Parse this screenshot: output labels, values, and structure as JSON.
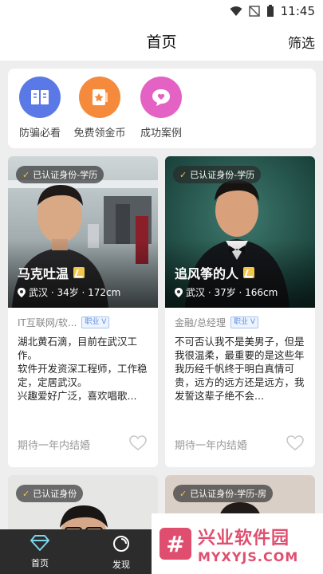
{
  "statusbar": {
    "time": "11:45"
  },
  "header": {
    "title": "首页",
    "filter": "筛选"
  },
  "quicknav": [
    {
      "label": "防骗必看",
      "icon": "book-icon",
      "color": "#5b79e6"
    },
    {
      "label": "免费领金币",
      "icon": "gift-icon",
      "color": "#f58a3c"
    },
    {
      "label": "成功案例",
      "icon": "heart-chat-icon",
      "color": "#e462c4"
    }
  ],
  "cards": [
    {
      "verify": "已认证身份-学历",
      "name": "马克吐温",
      "info": "武汉 · 34岁 · 172cm",
      "job": "IT互联网/软...",
      "job_badge": "职业",
      "intro": [
        "湖北黄石滴，目前在武汉工作。",
        "软件开发资深工程师，工作稳定，定居武汉。",
        "兴趣爱好广泛，喜欢唱歌..."
      ],
      "expect": "期待一年内结婚"
    },
    {
      "verify": "已认证身份-学历",
      "name": "追风筝的人",
      "info": "武汉 · 37岁 · 166cm",
      "job": "金融/总经理",
      "job_badge": "职业",
      "intro": [
        "不可否认我不是美男子，但是我很温柔，最重要的是这些年我历经千帆终于明白真情可贵，远方的远方还是远方，我发誓这辈子绝不会..."
      ],
      "expect": "期待一年内结婚"
    },
    {
      "verify": "已认证身份"
    },
    {
      "verify": "已认证身份-学历-房"
    }
  ],
  "tabs": [
    {
      "label": "首页",
      "icon": "diamond-icon",
      "active": true
    },
    {
      "label": "发现",
      "icon": "discover-icon",
      "active": false
    }
  ],
  "watermark": {
    "title": "兴业软件园",
    "subtitle": "MYXYJS.COM"
  }
}
